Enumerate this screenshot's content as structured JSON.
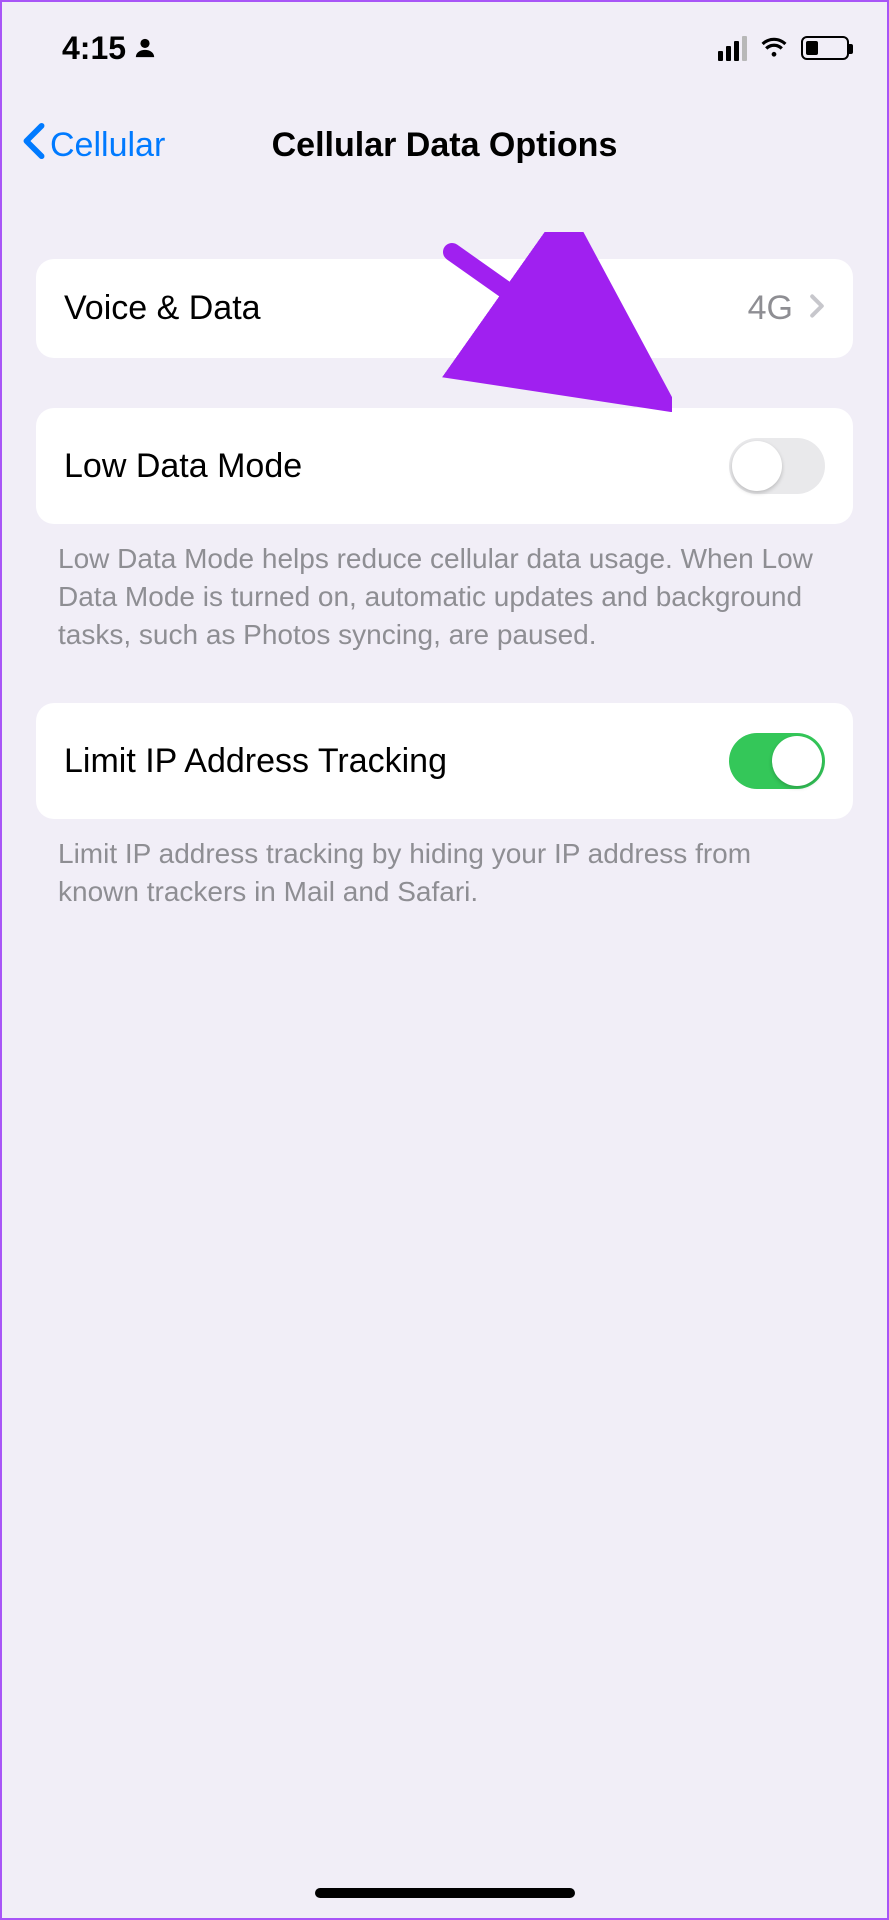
{
  "status": {
    "time": "4:15"
  },
  "nav": {
    "back_label": "Cellular",
    "title": "Cellular Data Options"
  },
  "voice_data": {
    "label": "Voice & Data",
    "value": "4G"
  },
  "low_data": {
    "label": "Low Data Mode",
    "enabled": false,
    "footer": "Low Data Mode helps reduce cellular data usage. When Low Data Mode is turned on, automatic updates and background tasks, such as Photos syncing, are paused."
  },
  "limit_ip": {
    "label": "Limit IP Address Tracking",
    "enabled": true,
    "footer": "Limit IP address tracking by hiding your IP address from known trackers in Mail and Safari."
  },
  "annotation": {
    "arrow_color": "#a020f0"
  }
}
